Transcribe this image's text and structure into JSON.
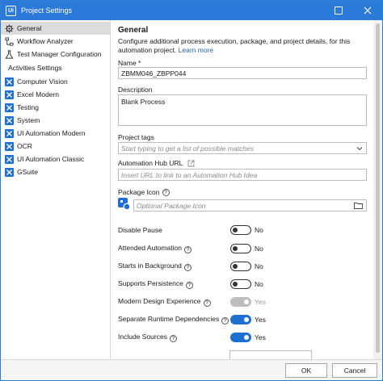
{
  "window": {
    "app_icon_text": "Ui",
    "title": "Project Settings"
  },
  "sidebar": {
    "items": [
      {
        "label": "General",
        "icon": "gear-icon"
      },
      {
        "label": "Workflow Analyzer",
        "icon": "workflow-analyzer-icon"
      },
      {
        "label": "Test Manager Configuration",
        "icon": "test-manager-icon"
      }
    ],
    "section_label": "Activities Settings",
    "activities": [
      {
        "label": "Computer Vision"
      },
      {
        "label": "Excel Modern"
      },
      {
        "label": "Testing"
      },
      {
        "label": "System"
      },
      {
        "label": "UI Automation Modern"
      },
      {
        "label": "OCR"
      },
      {
        "label": "UI Automation Classic"
      },
      {
        "label": "GSuite"
      }
    ]
  },
  "main": {
    "heading": "General",
    "description": "Configure additional process execution, package, and project details, for this automation project.",
    "learn_more": "Learn more",
    "name_label": "Name *",
    "name_value": "ZBMM046_ZBPP044",
    "description_label": "Description",
    "description_value": "Blank Process",
    "tags_label": "Project tags",
    "tags_placeholder": "Start typing to get a list of possible matches",
    "hub_label": "Automation Hub URL",
    "hub_placeholder": "Insert URL to link to an Automation Hub Idea",
    "package_icon_label": "Package Icon",
    "package_icon_placeholder": "Optional Package Icon",
    "help_glyph": "?",
    "toggles": [
      {
        "label": "Disable Pause",
        "help": true,
        "on": false,
        "disabled": false,
        "state": "No"
      },
      {
        "label": "Attended Automation",
        "help": true,
        "on": false,
        "disabled": false,
        "state": "No"
      },
      {
        "label": "Starts in Background",
        "help": true,
        "on": false,
        "disabled": false,
        "state": "No"
      },
      {
        "label": "Supports Persistence",
        "help": true,
        "on": false,
        "disabled": false,
        "state": "No"
      },
      {
        "label": "Modern Design Experience",
        "help": true,
        "on": true,
        "disabled": true,
        "state": "Yes"
      },
      {
        "label": "Separate Runtime Dependencies",
        "help": true,
        "on": true,
        "disabled": false,
        "state": "Yes"
      },
      {
        "label": "Include Sources",
        "help": true,
        "on": true,
        "disabled": false,
        "state": "Yes"
      }
    ]
  },
  "footer": {
    "ok_label": "OK",
    "cancel_label": "Cancel"
  },
  "colors": {
    "accent": "#2b79d8",
    "toggle_on": "#1d6fd1",
    "link": "#1a64c8"
  }
}
